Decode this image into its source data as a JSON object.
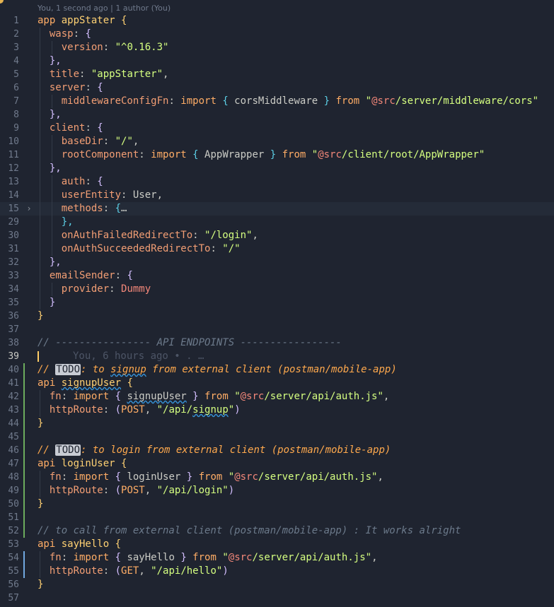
{
  "blame_header": "You, 1 second ago | 1 author (You)",
  "ghost_blame": "You, 6 hours ago • . …",
  "colors": {
    "background": "#1f2430",
    "keyword": "#ffad66",
    "property": "#f29e74",
    "string": "#d5ff80",
    "entity": "#ffd173",
    "comment": "#6c7a8b",
    "todo_comment": "#ffa94d",
    "added_marker": "#87d96c",
    "modified_marker": "#80bfff"
  },
  "lines": [
    {
      "n": "1",
      "segs": [
        [
          "k",
          "app "
        ],
        [
          "id",
          "appStater"
        ],
        [
          "br1",
          " {"
        ]
      ]
    },
    {
      "n": "2",
      "segs": [
        [
          "t",
          "  "
        ],
        [
          "p",
          "wasp"
        ],
        [
          "t",
          ": "
        ],
        [
          "br2",
          "{"
        ]
      ]
    },
    {
      "n": "3",
      "segs": [
        [
          "t",
          "    "
        ],
        [
          "p",
          "version"
        ],
        [
          "t",
          ": "
        ],
        [
          "s",
          "\"^0.16.3\""
        ]
      ]
    },
    {
      "n": "4",
      "segs": [
        [
          "t",
          "  "
        ],
        [
          "br2",
          "},"
        ]
      ]
    },
    {
      "n": "5",
      "segs": [
        [
          "t",
          "  "
        ],
        [
          "p",
          "title"
        ],
        [
          "t",
          ": "
        ],
        [
          "s",
          "\"appStarter\""
        ],
        [
          "t",
          ","
        ]
      ]
    },
    {
      "n": "6",
      "segs": [
        [
          "t",
          "  "
        ],
        [
          "p",
          "server"
        ],
        [
          "t",
          ": "
        ],
        [
          "br2",
          "{"
        ]
      ]
    },
    {
      "n": "7",
      "segs": [
        [
          "t",
          "    "
        ],
        [
          "p",
          "middlewareConfigFn"
        ],
        [
          "t",
          ": "
        ],
        [
          "k",
          "import "
        ],
        [
          "br3",
          "{ "
        ],
        [
          "t",
          "corsMiddleware"
        ],
        [
          "br3",
          " }"
        ],
        [
          "k",
          " from "
        ],
        [
          "s",
          "\""
        ],
        [
          "b",
          "@src"
        ],
        [
          "s",
          "/server/middleware/cors\""
        ]
      ]
    },
    {
      "n": "8",
      "segs": [
        [
          "t",
          "  "
        ],
        [
          "br2",
          "},"
        ]
      ]
    },
    {
      "n": "9",
      "segs": [
        [
          "t",
          "  "
        ],
        [
          "p",
          "client"
        ],
        [
          "t",
          ": "
        ],
        [
          "br2",
          "{"
        ]
      ]
    },
    {
      "n": "10",
      "segs": [
        [
          "t",
          "    "
        ],
        [
          "p",
          "baseDir"
        ],
        [
          "t",
          ": "
        ],
        [
          "s",
          "\"/\""
        ],
        [
          "t",
          ","
        ]
      ]
    },
    {
      "n": "11",
      "segs": [
        [
          "t",
          "    "
        ],
        [
          "p",
          "rootComponent"
        ],
        [
          "t",
          ": "
        ],
        [
          "k",
          "import "
        ],
        [
          "br3",
          "{ "
        ],
        [
          "t",
          "AppWrapper"
        ],
        [
          "br3",
          " }"
        ],
        [
          "k",
          " from "
        ],
        [
          "s",
          "\""
        ],
        [
          "b",
          "@src"
        ],
        [
          "s",
          "/client/root/AppWrapper\""
        ]
      ]
    },
    {
      "n": "12",
      "segs": [
        [
          "t",
          "  "
        ],
        [
          "br2",
          "},"
        ]
      ]
    },
    {
      "n": "13",
      "segs": [
        [
          "t",
          "    "
        ],
        [
          "p",
          "auth"
        ],
        [
          "t",
          ": "
        ],
        [
          "br2",
          "{"
        ]
      ]
    },
    {
      "n": "14",
      "segs": [
        [
          "t",
          "    "
        ],
        [
          "p",
          "userEntity"
        ],
        [
          "t",
          ": User,"
        ]
      ]
    },
    {
      "n": "15",
      "segs": [
        [
          "t",
          "    "
        ],
        [
          "p",
          "methods"
        ],
        [
          "t",
          ": "
        ],
        [
          "br3",
          "{"
        ],
        [
          "t",
          "…"
        ]
      ],
      "fold": "›",
      "active": true
    },
    {
      "n": "29",
      "segs": [
        [
          "t",
          "    "
        ],
        [
          "br3",
          "},"
        ]
      ]
    },
    {
      "n": "30",
      "segs": [
        [
          "t",
          "    "
        ],
        [
          "p",
          "onAuthFailedRedirectTo"
        ],
        [
          "t",
          ": "
        ],
        [
          "s",
          "\"/login\""
        ],
        [
          "t",
          ","
        ]
      ]
    },
    {
      "n": "31",
      "segs": [
        [
          "t",
          "    "
        ],
        [
          "p",
          "onAuthSucceededRedirectTo"
        ],
        [
          "t",
          ": "
        ],
        [
          "s",
          "\"/\""
        ]
      ]
    },
    {
      "n": "32",
      "segs": [
        [
          "t",
          "  "
        ],
        [
          "br2",
          "},"
        ]
      ]
    },
    {
      "n": "33",
      "segs": [
        [
          "t",
          "  "
        ],
        [
          "p",
          "emailSender"
        ],
        [
          "t",
          ": "
        ],
        [
          "br2",
          "{"
        ]
      ]
    },
    {
      "n": "34",
      "segs": [
        [
          "t",
          "    "
        ],
        [
          "p",
          "provider"
        ],
        [
          "t",
          ": "
        ],
        [
          "b",
          "Dummy"
        ]
      ]
    },
    {
      "n": "35",
      "segs": [
        [
          "t",
          "  "
        ],
        [
          "br2",
          "}"
        ]
      ]
    },
    {
      "n": "36",
      "segs": [
        [
          "br1",
          "}"
        ]
      ]
    },
    {
      "n": "37",
      "segs": []
    },
    {
      "n": "38",
      "segs": [
        [
          "c",
          "// ---------------- API ENDPOINTS -----------------"
        ]
      ]
    },
    {
      "n": "39",
      "segs": [],
      "current": true,
      "cursor": true,
      "ghost": true
    },
    {
      "n": "40",
      "segs": [
        [
          "cw",
          "// "
        ],
        [
          "todo",
          "TODO"
        ],
        [
          "cw",
          ": to "
        ],
        [
          "cwsq",
          "signup"
        ],
        [
          "cw",
          " from external client (postman/mobile-app)"
        ]
      ],
      "gutter": "added"
    },
    {
      "n": "41",
      "segs": [
        [
          "k",
          "api "
        ],
        [
          "idsq",
          "signupUser"
        ],
        [
          "br1",
          " {"
        ]
      ],
      "gutter": "added"
    },
    {
      "n": "42",
      "segs": [
        [
          "t",
          "  "
        ],
        [
          "p",
          "fn"
        ],
        [
          "t",
          ": "
        ],
        [
          "k",
          "import "
        ],
        [
          "br2",
          "{ "
        ],
        [
          "tsq",
          "signupUser"
        ],
        [
          "br2",
          " }"
        ],
        [
          "k",
          " from "
        ],
        [
          "s",
          "\""
        ],
        [
          "b",
          "@src"
        ],
        [
          "s",
          "/server/api/auth.js\""
        ],
        [
          "t",
          ","
        ]
      ],
      "gutter": "added"
    },
    {
      "n": "43",
      "segs": [
        [
          "t",
          "  "
        ],
        [
          "p",
          "httpRoute"
        ],
        [
          "t",
          ": "
        ],
        [
          "br2",
          "("
        ],
        [
          "o",
          "POST"
        ],
        [
          "t",
          ", "
        ],
        [
          "s",
          "\"/api/"
        ],
        [
          "ssq",
          "signup"
        ],
        [
          "s",
          "\""
        ],
        [
          "br2",
          ")"
        ]
      ],
      "gutter": "added"
    },
    {
      "n": "44",
      "segs": [
        [
          "br1",
          "}"
        ]
      ],
      "gutter": "added"
    },
    {
      "n": "45",
      "segs": [],
      "gutter": "added"
    },
    {
      "n": "46",
      "segs": [
        [
          "cw",
          "// "
        ],
        [
          "todo",
          "TODO"
        ],
        [
          "cw",
          ": to login from external client (postman/mobile-app)"
        ]
      ],
      "gutter": "added"
    },
    {
      "n": "47",
      "segs": [
        [
          "k",
          "api "
        ],
        [
          "id",
          "loginUser"
        ],
        [
          "br1",
          " {"
        ]
      ],
      "gutter": "added"
    },
    {
      "n": "48",
      "segs": [
        [
          "t",
          "  "
        ],
        [
          "p",
          "fn"
        ],
        [
          "t",
          ": "
        ],
        [
          "k",
          "import "
        ],
        [
          "br2",
          "{ "
        ],
        [
          "t",
          "loginUser"
        ],
        [
          "br2",
          " }"
        ],
        [
          "k",
          " from "
        ],
        [
          "s",
          "\""
        ],
        [
          "b",
          "@src"
        ],
        [
          "s",
          "/server/api/auth.js\""
        ],
        [
          "t",
          ","
        ]
      ],
      "gutter": "added"
    },
    {
      "n": "49",
      "segs": [
        [
          "t",
          "  "
        ],
        [
          "p",
          "httpRoute"
        ],
        [
          "t",
          ": "
        ],
        [
          "br2",
          "("
        ],
        [
          "o",
          "POST"
        ],
        [
          "t",
          ", "
        ],
        [
          "s",
          "\"/api/login\""
        ],
        [
          "br2",
          ")"
        ]
      ],
      "gutter": "added"
    },
    {
      "n": "50",
      "segs": [
        [
          "br1",
          "}"
        ]
      ],
      "gutter": "added"
    },
    {
      "n": "51",
      "segs": [],
      "gutter": "added"
    },
    {
      "n": "52",
      "segs": [
        [
          "c",
          "// to call from external client (postman/mobile-app) : It works alright"
        ]
      ],
      "gutter": "added"
    },
    {
      "n": "53",
      "segs": [
        [
          "k",
          "api "
        ],
        [
          "id",
          "sayHello"
        ],
        [
          "br1",
          " {"
        ]
      ]
    },
    {
      "n": "54",
      "segs": [
        [
          "t",
          "  "
        ],
        [
          "p",
          "fn"
        ],
        [
          "t",
          ": "
        ],
        [
          "k",
          "import "
        ],
        [
          "br2",
          "{ "
        ],
        [
          "t",
          "sayHello"
        ],
        [
          "br2",
          " }"
        ],
        [
          "k",
          " from "
        ],
        [
          "s",
          "\""
        ],
        [
          "b",
          "@src"
        ],
        [
          "s",
          "/server/api/auth.js\""
        ],
        [
          "t",
          ","
        ]
      ],
      "gutter": "modified"
    },
    {
      "n": "55",
      "segs": [
        [
          "t",
          "  "
        ],
        [
          "p",
          "httpRoute"
        ],
        [
          "t",
          ": "
        ],
        [
          "br2",
          "("
        ],
        [
          "o",
          "GET"
        ],
        [
          "t",
          ", "
        ],
        [
          "s",
          "\"/api/hello\""
        ],
        [
          "br2",
          ")"
        ]
      ],
      "gutter": "modified"
    },
    {
      "n": "56",
      "segs": [
        [
          "br1",
          "}"
        ]
      ]
    },
    {
      "n": "57",
      "segs": []
    }
  ]
}
